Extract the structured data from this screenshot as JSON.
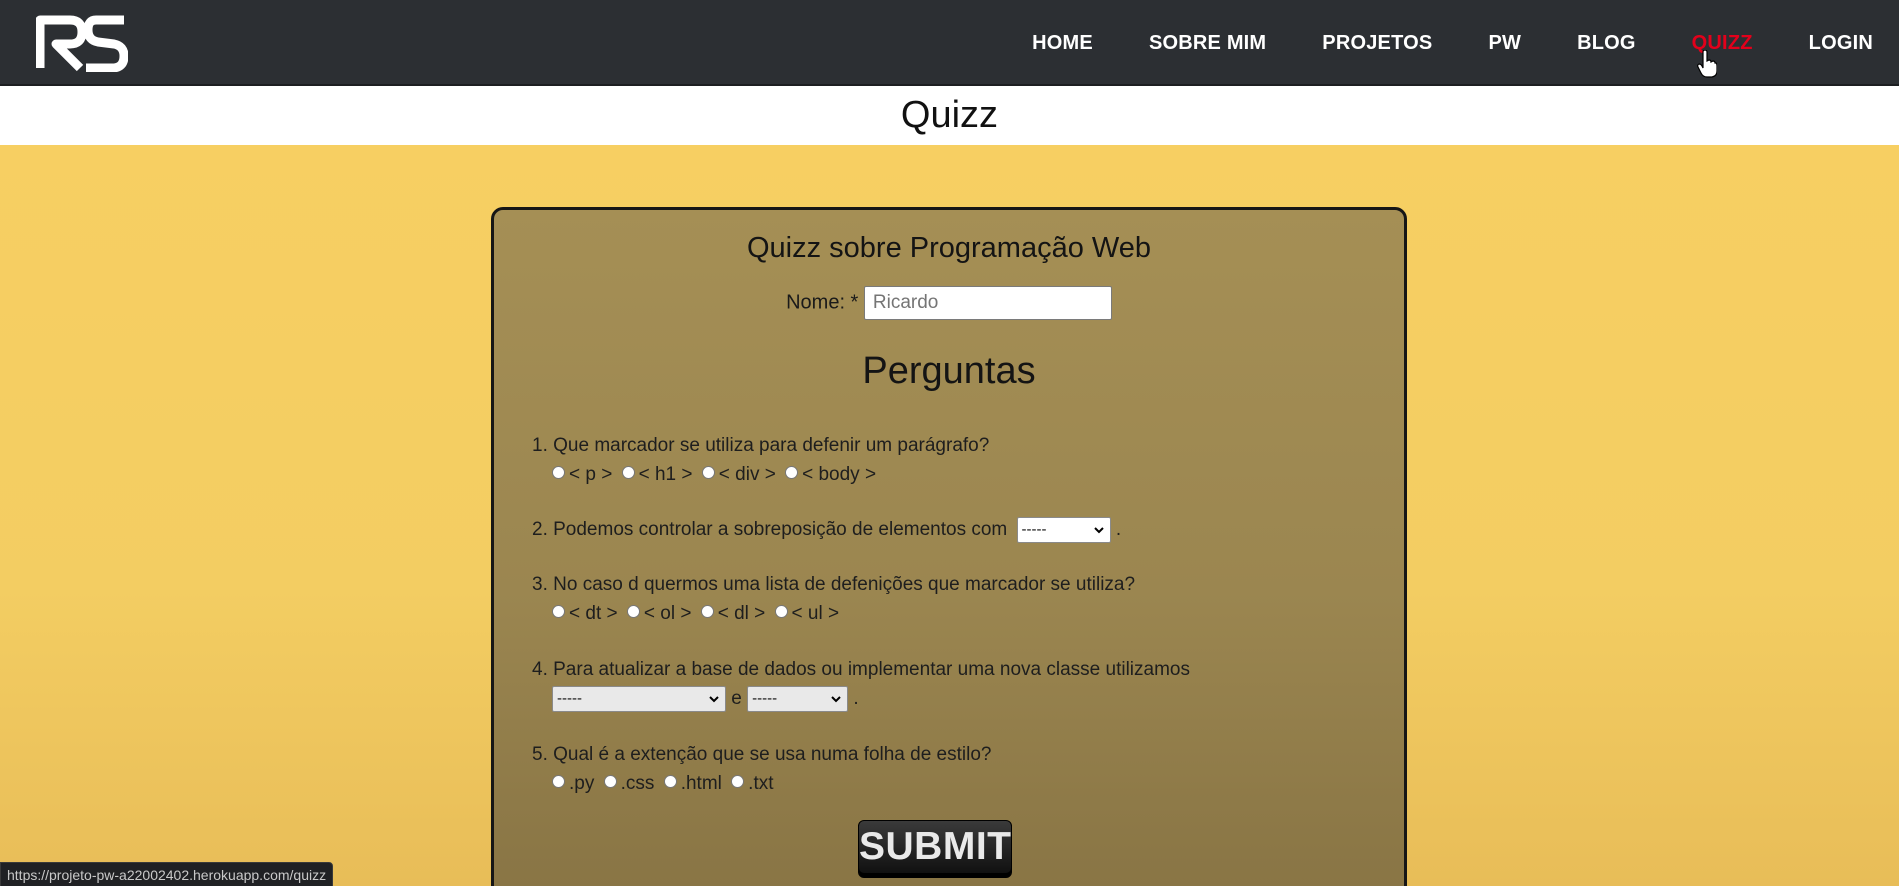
{
  "nav": {
    "logo_text": "RS",
    "items": [
      {
        "label": "HOME",
        "active": false
      },
      {
        "label": "SOBRE MIM",
        "active": false
      },
      {
        "label": "PROJETOS",
        "active": false
      },
      {
        "label": "PW",
        "active": false
      },
      {
        "label": "BLOG",
        "active": false
      },
      {
        "label": "QUIZZ",
        "active": true
      },
      {
        "label": "LOGIN",
        "active": false
      }
    ],
    "active_color": "#e3001b"
  },
  "page_title": "Quizz",
  "quiz": {
    "title": "Quizz sobre Programação Web",
    "name_label": "Nome: *",
    "name_placeholder": "Ricardo",
    "questions_heading": "Perguntas",
    "q1": {
      "text": "1. Que marcador se utiliza para defenir um parágrafo?",
      "options": [
        "< p >",
        "< h1 >",
        "< div >",
        "< body >"
      ]
    },
    "q2": {
      "text": "2. Podemos controlar a sobreposição de elementos com",
      "select_value": "-----",
      "suffix": "."
    },
    "q3": {
      "text": "3. No caso d quermos uma lista de defenições que marcador se utiliza?",
      "options": [
        "< dt >",
        "< ol >",
        "< dl >",
        "< ul >"
      ]
    },
    "q4": {
      "text": "4. Para atualizar a base de dados ou implementar uma nova classe utilizamos",
      "select1_value": "-----",
      "connector": "e",
      "select2_value": "-----",
      "suffix": "."
    },
    "q5": {
      "text": "5. Qual é a extenção que se usa numa folha de estilo?",
      "options": [
        ".py",
        ".css",
        ".html",
        ".txt"
      ]
    },
    "submit_label": "SUBMIT"
  },
  "status_bar_url": "https://projeto-pw-a22002402.herokuapp.com/quizz",
  "colors": {
    "navbar": "#2c2f33",
    "page_background": "#f7cf62",
    "card_background": "#a58f55"
  }
}
